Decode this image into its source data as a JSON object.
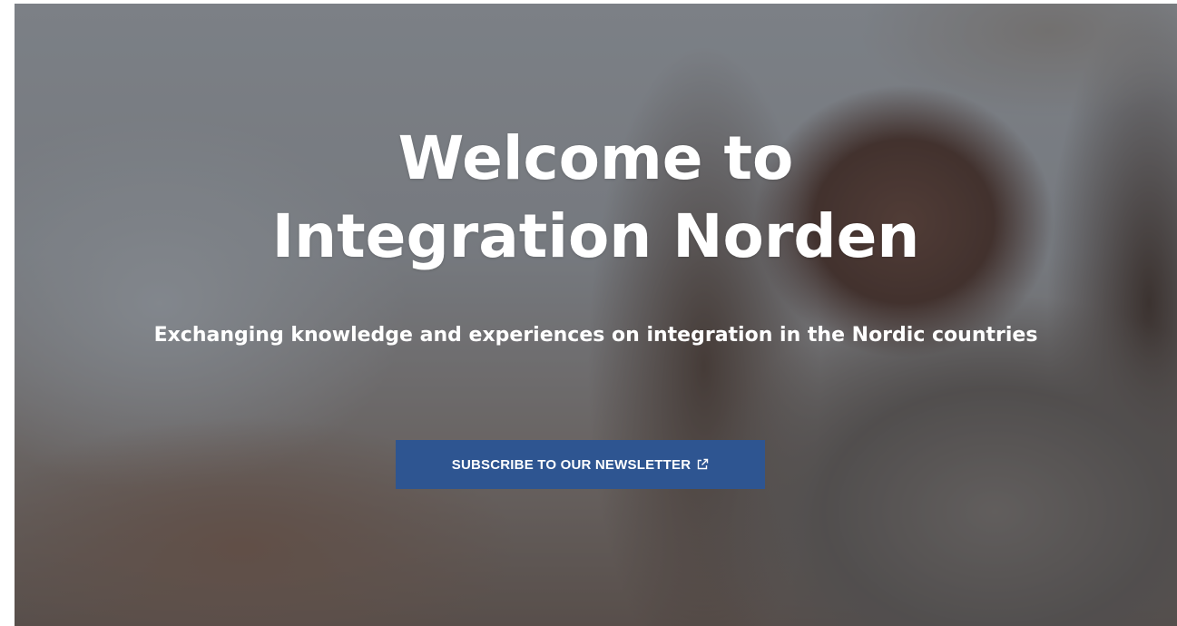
{
  "hero": {
    "title_line1": "Welcome to",
    "title_line2": "Integration Norden",
    "subtitle": "Exchanging knowledge and experiences on integration in the Nordic countries",
    "button_label": "SUBSCRIBE TO OUR NEWSLETTER",
    "button_icon": "external-link-icon",
    "button_color": "#2e5591",
    "background_image": "smiling-woman-in-knit-scarf-photo"
  }
}
